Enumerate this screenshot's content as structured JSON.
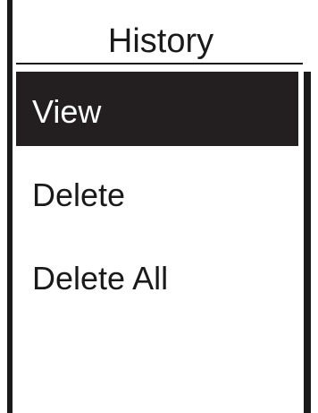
{
  "screen": {
    "title": "History"
  },
  "menu": {
    "items": [
      {
        "label": "View",
        "selected": true
      },
      {
        "label": "Delete",
        "selected": false
      },
      {
        "label": "Delete All",
        "selected": false
      }
    ]
  },
  "colors": {
    "foreground": "#1a1a1a",
    "highlight_background": "#231f20",
    "highlight_text": "#ffffff",
    "background": "#ffffff"
  }
}
